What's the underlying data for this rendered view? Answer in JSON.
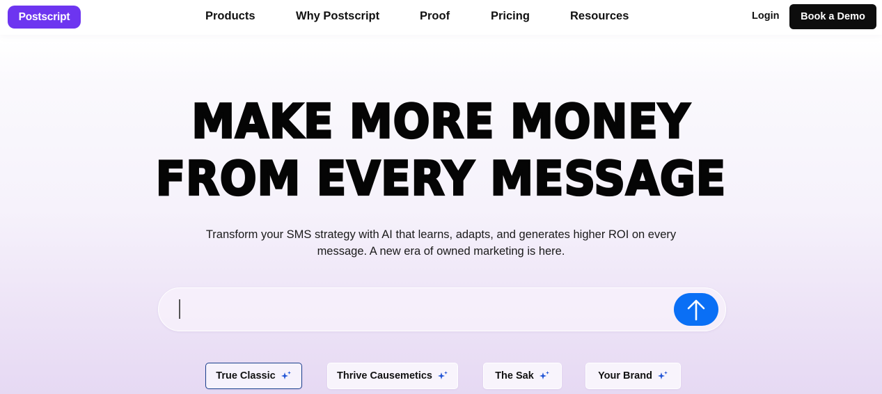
{
  "brand": {
    "logo_text": "Postscript",
    "accent": "#6d35f0"
  },
  "nav": {
    "links": [
      "Products",
      "Why Postscript",
      "Proof",
      "Pricing",
      "Resources"
    ],
    "login": "Login",
    "cta": "Book a Demo"
  },
  "hero": {
    "headline_line1": "MAKE MORE MONEY",
    "headline_line2": "FROM EVERY MESSAGE",
    "subtitle_line1": "Transform your SMS strategy with AI that learns, adapts, and generates higher ROI on every",
    "subtitle_line2": "message. A new era of owned marketing is here."
  },
  "prompt": {
    "value": "",
    "placeholder": "",
    "send_icon": "arrow-up-icon",
    "send_color": "#0a6ff5"
  },
  "chips": [
    {
      "label": "True Classic",
      "icon": "sparkle-icon",
      "selected": true
    },
    {
      "label": "Thrive Causemetics",
      "icon": "sparkle-icon",
      "selected": false
    },
    {
      "label": "The Sak",
      "icon": "sparkle-icon",
      "selected": false
    },
    {
      "label": "Your Brand",
      "icon": "sparkle-icon",
      "selected": false
    }
  ]
}
